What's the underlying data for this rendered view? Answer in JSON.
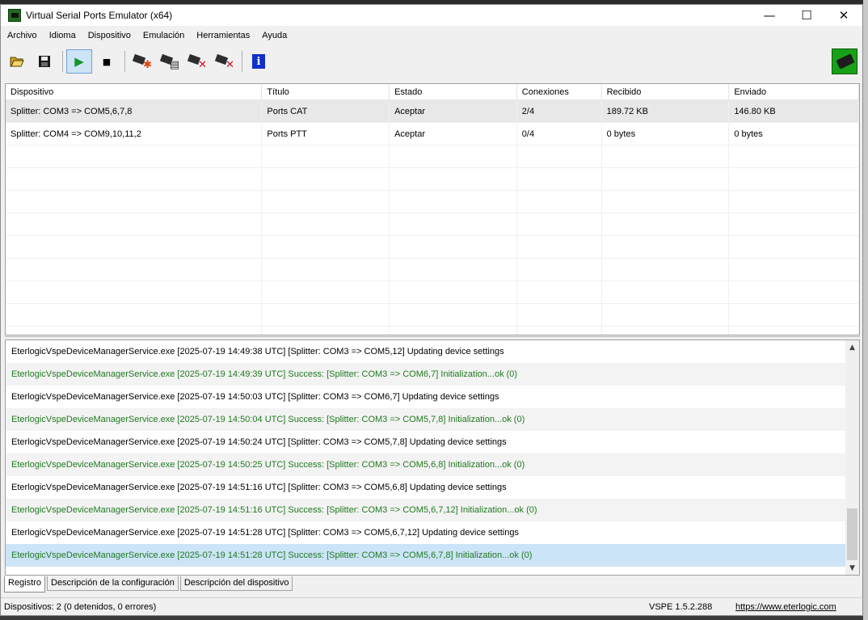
{
  "window": {
    "title": "Virtual Serial Ports Emulator (x64)",
    "minimize": "—",
    "maximize": "☐",
    "close": "✕"
  },
  "menu": [
    "Archivo",
    "Idioma",
    "Dispositivo",
    "Emulación",
    "Herramientas",
    "Ayuda"
  ],
  "toolbar": {
    "open_icon": "folder-open-icon",
    "save_icon": "floppy-icon",
    "play_icon": "play-icon",
    "stop_icon": "stop-icon",
    "info_label": "i",
    "play_glyph": "▶",
    "stop_glyph": "■"
  },
  "table": {
    "headers": [
      "Dispositivo",
      "Título",
      "Estado",
      "Conexiones",
      "Recibido",
      "Enviado"
    ],
    "rows": [
      [
        "Splitter: COM3 => COM5,6,7,8",
        "Ports CAT",
        "Aceptar",
        "2/4",
        "189.72 KB",
        "146.80 KB"
      ],
      [
        "Splitter: COM4 => COM9,10,11,2",
        "Ports PTT",
        "Aceptar",
        "0/4",
        "0 bytes",
        "0 bytes"
      ]
    ]
  },
  "log": [
    {
      "text": "EterlogicVspeDeviceManagerService.exe [2025-07-19 14:49:38 UTC] [Splitter: COM3 => COM5,12] Updating device settings",
      "type": "info"
    },
    {
      "text": "EterlogicVspeDeviceManagerService.exe [2025-07-19 14:49:39 UTC] Success: [Splitter: COM3 => COM6,7] Initialization...ok  (0)",
      "type": "success"
    },
    {
      "text": "EterlogicVspeDeviceManagerService.exe [2025-07-19 14:50:03 UTC] [Splitter: COM3 => COM6,7] Updating device settings",
      "type": "info"
    },
    {
      "text": "EterlogicVspeDeviceManagerService.exe [2025-07-19 14:50:04 UTC] Success: [Splitter: COM3 => COM5,7,8] Initialization...ok  (0)",
      "type": "success"
    },
    {
      "text": "EterlogicVspeDeviceManagerService.exe [2025-07-19 14:50:24 UTC] [Splitter: COM3 => COM5,7,8] Updating device settings",
      "type": "info"
    },
    {
      "text": "EterlogicVspeDeviceManagerService.exe [2025-07-19 14:50:25 UTC] Success: [Splitter: COM3 => COM5,6,8] Initialization...ok  (0)",
      "type": "success"
    },
    {
      "text": "EterlogicVspeDeviceManagerService.exe [2025-07-19 14:51:16 UTC] [Splitter: COM3 => COM5,6,8] Updating device settings",
      "type": "info"
    },
    {
      "text": "EterlogicVspeDeviceManagerService.exe [2025-07-19 14:51:16 UTC] Success: [Splitter: COM3 => COM5,6,7,12] Initialization...ok  (0)",
      "type": "success"
    },
    {
      "text": "EterlogicVspeDeviceManagerService.exe [2025-07-19 14:51:28 UTC] [Splitter: COM3 => COM5,6,7,12] Updating device settings",
      "type": "info"
    },
    {
      "text": "EterlogicVspeDeviceManagerService.exe [2025-07-19 14:51:28 UTC] Success: [Splitter: COM3 => COM5,6,7,8] Initialization...ok  (0)",
      "type": "success"
    }
  ],
  "tabs": [
    "Registro",
    "Descripción de la configuración",
    "Descripción del dispositivo"
  ],
  "status": {
    "devices": "Dispositivos: 2 (0 detenidos, 0 errores)",
    "version": "VSPE 1.5.2.288",
    "link": "https://www.eterlogic.com"
  },
  "colors": {
    "success_text": "#1f7a1f",
    "selected_row": "#cce4f7"
  }
}
